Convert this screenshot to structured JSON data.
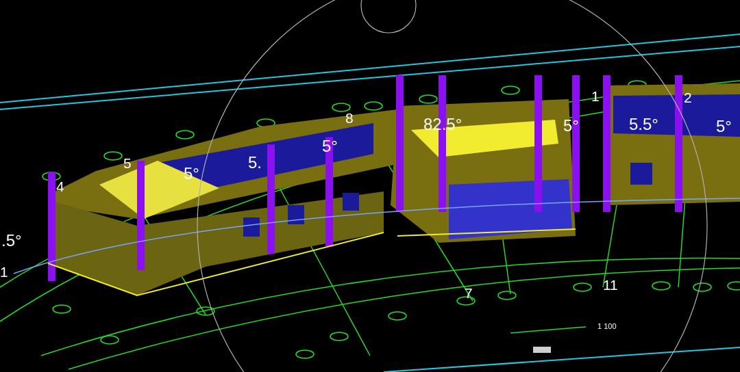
{
  "viewport": {
    "labels": [
      {
        "kind": "angle",
        "text": "82.5°"
      },
      {
        "kind": "angle",
        "text": "5°"
      },
      {
        "kind": "angle",
        "text": "5.5°"
      },
      {
        "kind": "angle",
        "text": "5°"
      },
      {
        "kind": "angle",
        "text": ".5°"
      },
      {
        "kind": "angle",
        "text": "5°"
      },
      {
        "kind": "angle",
        "text": "5."
      },
      {
        "kind": "angle",
        "text": "5°"
      },
      {
        "kind": "axis",
        "text": "4"
      },
      {
        "kind": "axis",
        "text": "5"
      },
      {
        "kind": "axis",
        "text": "8"
      },
      {
        "kind": "axis",
        "text": "1"
      },
      {
        "kind": "axis",
        "text": "2"
      },
      {
        "kind": "axis",
        "text": "7"
      },
      {
        "kind": "axis",
        "text": "11"
      },
      {
        "kind": "axis",
        "text": "1"
      },
      {
        "kind": "scale",
        "text": "1 100"
      }
    ]
  }
}
